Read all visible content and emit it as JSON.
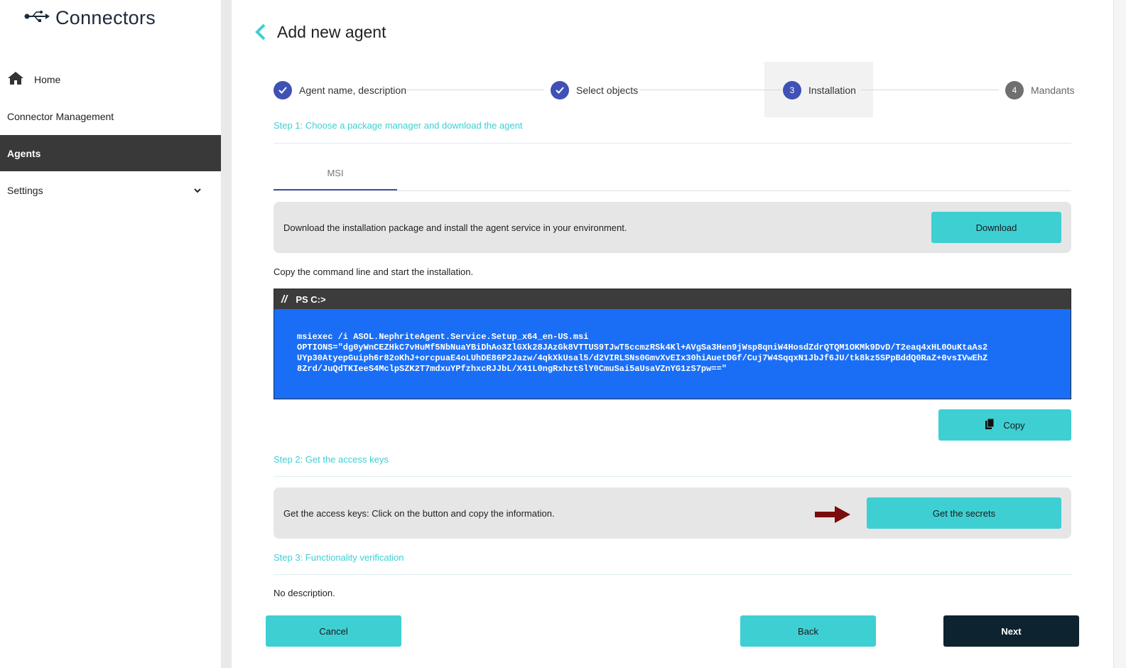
{
  "brand": {
    "name": "Connectors"
  },
  "sidebar": {
    "items": [
      {
        "label": "Home",
        "icon": "home-icon"
      },
      {
        "label": "Connector Management"
      },
      {
        "label": "Agents",
        "active": true
      },
      {
        "label": "Settings",
        "icon": "chevron-down-icon"
      }
    ]
  },
  "page": {
    "title": "Add new agent"
  },
  "stepper": {
    "steps": [
      {
        "label": "Agent name, description",
        "state": "done"
      },
      {
        "label": "Select objects",
        "state": "done"
      },
      {
        "label": "Installation",
        "number": "3",
        "state": "active"
      },
      {
        "label": "Mandants",
        "number": "4",
        "state": "pending"
      }
    ]
  },
  "step1": {
    "title": "Step 1: Choose a package manager and download the agent",
    "tab": "MSI",
    "download_text": "Download the installation package and install the agent service in your environment.",
    "download_button": "Download",
    "copy_instruction": "Copy the command line and start the installation.",
    "console_prompt": "PS C:>",
    "command_lines": [
      "msiexec /i ASOL.NephriteAgent.Service.Setup_x64_en-US.msi",
      "OPTIONS=\"dg0yWnCEZHkC7vHuMf5NbNuaYBiDhAo3ZlGXk28JAzGk8VTTUS9TJwT5ccmzRSk4Kl+AVgSa3Hen9jWsp8qniW4HosdZdrQTQM1OKMk9DvD/T2eaq4xHL0OuKtaAs2",
      "UYp30AtyepGuiph6r82oKhJ+orcpuaE4oLUhDE86P2Jazw/4qkXkUsal5/d2VIRLSNs0GmvXvEIx30hiAuetDGf/Cuj7W4SqqxN1JbJf6JU/tk8kz5SPpBddQ0RaZ+0vsIVwEhZ",
      "8Zrd/JuQdTKIeeS4MclpSZK2T7mdxuYPfzhxcRJJbL/X41L0ngRxhztSlY0CmuSai5aUsaVZnYG1zS7pw==\""
    ],
    "copy_button": "Copy"
  },
  "step2": {
    "title": "Step 2: Get the access keys",
    "text": "Get the access keys: Click on the button and copy the information.",
    "button": "Get the secrets"
  },
  "step3": {
    "title": "Step 3: Functionality verification",
    "description": "No description."
  },
  "footer": {
    "cancel": "Cancel",
    "back": "Back",
    "next": "Next"
  },
  "colors": {
    "accent": "#3ecfd3",
    "primary": "#3f51b5",
    "code_bg": "#1a6ef5",
    "dark_button": "#0d2330",
    "active_nav": "#393939",
    "arrow": "#7a0c0c"
  }
}
